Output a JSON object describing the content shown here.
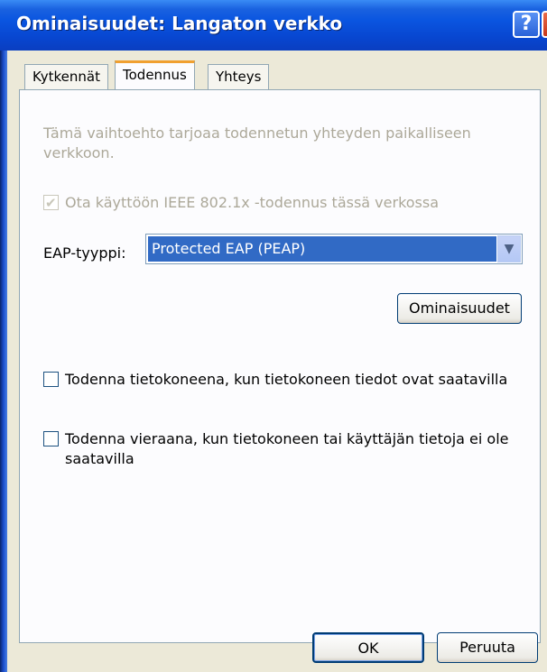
{
  "window": {
    "title": "Ominaisuudet: Langaton verkko",
    "help_label": "?",
    "close_label": "✕"
  },
  "tabs": [
    {
      "label": "Kytkennät",
      "active": false
    },
    {
      "label": "Todennus",
      "active": true
    },
    {
      "label": "Yhteys",
      "active": false
    }
  ],
  "auth": {
    "description": "Tämä vaihtoehto tarjoaa todennetun yhteyden paikalliseen verkkoon.",
    "enable_8021x": {
      "label": "Ota käyttöön IEEE 802.1x -todennus tässä verkossa",
      "checked": true,
      "enabled": false
    },
    "eap_label": "EAP-tyyppi:",
    "eap_value": "Protected EAP (PEAP)",
    "properties_button": "Ominaisuudet",
    "auth_as_computer": {
      "label": "Todenna tietokoneena, kun tietokoneen tiedot ovat saatavilla",
      "checked": false
    },
    "auth_as_guest": {
      "label": "Todenna vieraana, kun tietokoneen tai käyttäjän tietoja ei ole saatavilla",
      "checked": false
    }
  },
  "buttons": {
    "ok": "OK",
    "cancel": "Peruuta"
  },
  "colors": {
    "titlebar": "#0a55e0",
    "selection": "#316ac5",
    "dialog_bg": "#ece9d8"
  },
  "icons": {
    "check": "checkmark-icon",
    "dropdown": "chevron-down-icon"
  }
}
